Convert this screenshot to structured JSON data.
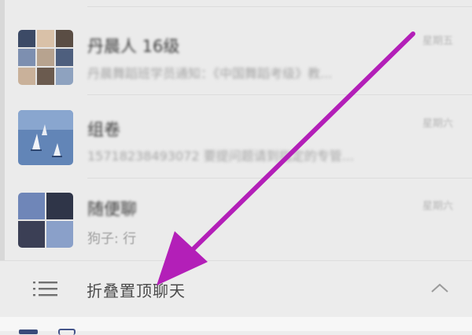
{
  "chats": [
    {
      "name": "丹晨人 16级",
      "preview": "丹晨舞蹈班学员通知：《中国舞蹈考级》教...",
      "time": "星期五",
      "avatar_colors": [
        "#3c4a66",
        "#d9c1a8",
        "#5a4d44",
        "#7d8fb0",
        "#b7a38f",
        "#4e5f7e",
        "#c9b19a",
        "#6b5b4f",
        "#8ea2bf"
      ]
    },
    {
      "name": "组卷",
      "preview": "15718238493072 要提问题请到指定的专管...",
      "time": "星期六",
      "avatar_colors": [
        "#5c7fb0",
        "#e9eef5"
      ]
    },
    {
      "name": "随便聊",
      "preview": "狗子: 行",
      "time": "星期六",
      "avatar_colors": [
        "#6f86b8",
        "#2f3548",
        "#3b3f55",
        "#8aa0c9"
      ]
    }
  ],
  "fold_bar": {
    "label": "折叠置顶聊天",
    "list_icon": "list-icon",
    "chevron_icon": "chevron-up-icon"
  },
  "annotation": {
    "color": "#b31fb8",
    "shape": "arrow"
  }
}
